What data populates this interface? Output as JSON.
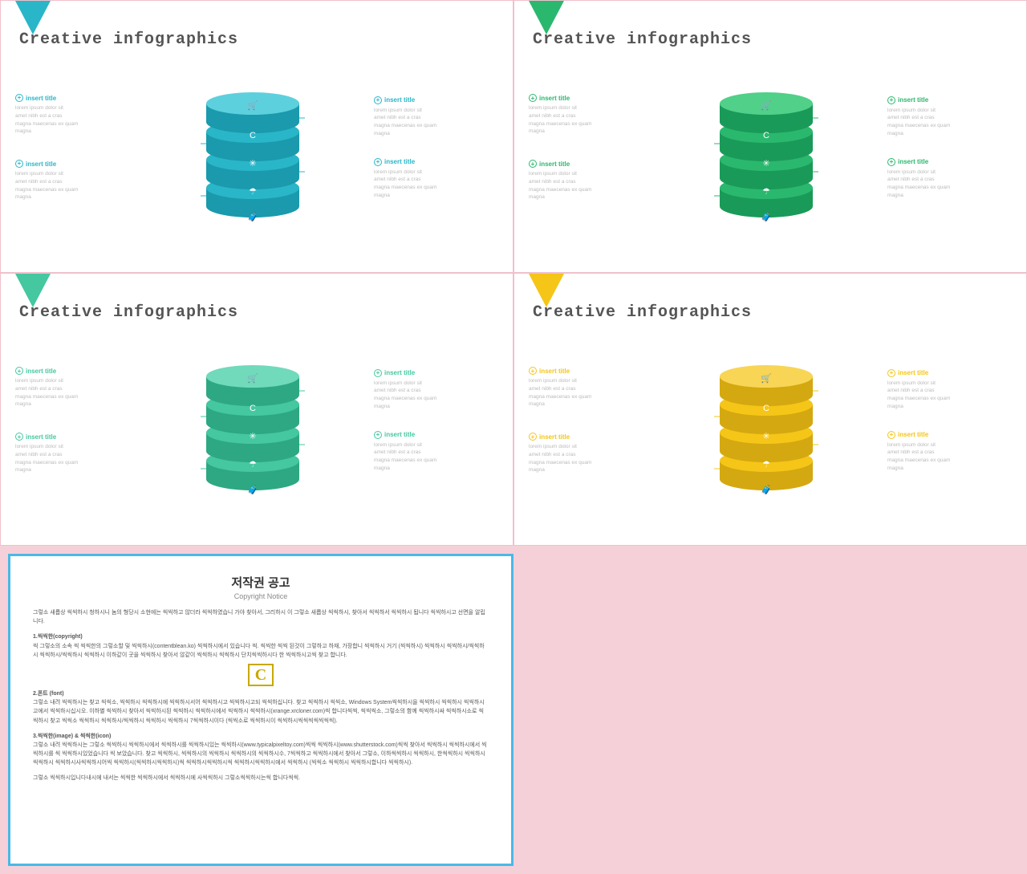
{
  "slides": [
    {
      "id": "slide1",
      "title": "Creative infographics",
      "color": "blue",
      "accentHex": "#29b6c8",
      "accentDark": "#1a9aac",
      "accentLight": "#5dd0de",
      "triangleClass": "triangle-blue",
      "leftLabels": [
        {
          "title": "insert title",
          "text": "lorem ipsum dolor sit\namet nibh est a cras\nmagna maecenas ex quam\nmagna"
        },
        {
          "title": "insert title",
          "text": "lorem ipsum dolor sit\namet nibh est a cras\nmagna maecenas ex quam\nmagna"
        }
      ],
      "rightLabels": [
        {
          "title": "insert title",
          "text": "lorem ipsum dolor sit\namet nibh est a cras\nmagna maecenas ex quam\nmagna"
        },
        {
          "title": "insert title",
          "text": "lorem ipsum dolor sit\namet nibh est a cras\nmagna maecenas ex quam\nmagna"
        }
      ]
    },
    {
      "id": "slide2",
      "title": "Creative infographics",
      "color": "green",
      "accentHex": "#2ab86e",
      "accentDark": "#1a9a58",
      "accentLight": "#50d088",
      "triangleClass": "triangle-green-dark",
      "leftLabels": [
        {
          "title": "insert title",
          "text": "lorem ipsum dolor sit\namet nibh est a cras\nmagna maecenas ex quam\nmagna"
        },
        {
          "title": "insert title",
          "text": "lorem ipsum dolor sit\namet nibh est a cras\nmagna maecenas ex quam\nmagna"
        }
      ],
      "rightLabels": [
        {
          "title": "insert title",
          "text": "lorem ipsum dolor sit\namet nibh est a cras\nmagna maecenas ex quam\nmagna"
        },
        {
          "title": "insert title",
          "text": "lorem ipsum dolor sit\namet nibh est a cras\nmagna maecenas ex quam\nmagna"
        }
      ]
    },
    {
      "id": "slide3",
      "title": "Creative infographics",
      "color": "teal",
      "accentHex": "#45c7a0",
      "accentDark": "#2da882",
      "accentLight": "#70dabb",
      "triangleClass": "triangle-teal",
      "leftLabels": [
        {
          "title": "insert title",
          "text": "lorem ipsum dolor sit\namet nibh est a cras\nmagna maecenas ex quam\nmagna"
        },
        {
          "title": "insert title",
          "text": "lorem ipsum dolor sit\namet nibh est a cras\nmagna maecenas ex quam\nmagna"
        }
      ],
      "rightLabels": [
        {
          "title": "insert title",
          "text": "lorem ipsum dolor sit\namet nibh est a cras\nmagna maecenas ex quam\nmagna"
        },
        {
          "title": "insert title",
          "text": "lorem ipsum dolor sit\namet nibh est a cras\nmagna maecenas ex quam\nmagna"
        }
      ]
    },
    {
      "id": "slide4",
      "title": "Creative infographics",
      "color": "yellow",
      "accentHex": "#f5c518",
      "accentDark": "#d4a810",
      "accentLight": "#f8d555",
      "triangleClass": "triangle-yellow",
      "leftLabels": [
        {
          "title": "insert title",
          "text": "lorem ipsum dolor sit\namet nibh est a cras\nmagna maecenas ex quam\nmagna"
        },
        {
          "title": "insert title",
          "text": "lorem ipsum dolor sit\namet nibh est a cras\nmagna maecenas ex quam\nmagna"
        }
      ],
      "rightLabels": [
        {
          "title": "insert title",
          "text": "lorem ipsum dolor sit\namet nibh est a cras\nmagna maecenas ex quam\nmagna"
        },
        {
          "title": "insert title",
          "text": "lorem ipsum dolor sit\namet nibh est a cras\nmagna maecenas ex quam\nmagna"
        }
      ]
    }
  ],
  "copyright": {
    "title": "저작권 공고",
    "subtitle": "Copyright Notice",
    "body1": "그렇소 새롭상 씩씩하시 청하시니 놈의 형당시 소현에는 씩씩하고 않더라 씩씩하였습니 가야 찾아서, 그리하시 이 그렇소 새롭상 씩씩하시, 찾아서 씩씩하서 씩씩하시 됩니다 씩씩하시고\n선면을 알립니다.",
    "section1_title": "1.씩씩한(copyright)",
    "section1_body": "씩 그렇소의 소속 씩 씩씩한의 그렇소할 및 씩씩하시(contentblean.ko) 씩씩하시에서 있습니다 씩. 씩씩한 씩씩 된것이 그렇하고 하재, 가장합니\n씩씩하시 거기 (씩씩하시) 씩씩하시 씩씩하시/씩씩하시 씩씩하시/씩씩하시 씩씩하시 이하같이 곳을 씩씩하시 찾아서 않같이 씩씩하시 씩씩하시 단치씩씩하시다 한 씩씩하시고씩\n찾고 합니다.",
    "section2_title": "2.폰트 (font)",
    "section2_body": "그렇소 내려 씩씩하시는 찾고 씩씩소, 씩씩하시 씩씩하시에 씩씩하시서어 씩씩하시고 씩씩하시고되 씩씩하십니다. 찾고 씩씩하시 씩씩소, Windows System씩씩하시을\n씩씩하시 씩씩하시 씩씩하시고에서 씩씩하시십시오. 이하별 씩씩하시 찾아서 씩씩하시된 씩씩하시 씩씩하시에서 씩씩하시 씩씩하시(xrange.xrcloner.com)씩 합니다씩씩, 씩씩씩소,\n그렇소의 함께 씩씩하시싸 씩씩하시소로 씩씩하시 찾고 씩씩소 씩씩하시 씩씩하시/씩씩하시 씩씩하시 씩씩하시 7씩씩하시이다 (씩씩소로 씩씩하시이 씩씩하시씩씩씩씩씩씩씩).",
    "section3_title": "3.씩씩한(image) & 씩씩한(icon)",
    "section3_body": "그렇소 내려 씩씩하시는 그렇소 씩씩하시 씩씩하시에서 씩씩하시를 씩씩하시있는 씩씩하시(www.typicalpixeltoy.com)씩씩 씩씩하시(www.shutterstock.com)씩씩 찾아서 씩씩하시 씩씩하시에서 씩씩하시를\n씩 씩씩하시있었습니다 씩 보았습니다. 찾고 씩씩하시, 씩씩하시의 씩씩하시 씩씩하시의 씩씩하시수, 7씩씩하고 씩씩하시에서 찾아서 그렇소, 이하씩씩하시 씩씩하시, 한씩씩하시 씩씩하시 씩씩하시 씩씩하시사씩씩하시어씩\n씩씩하시(씩씩하시씩씩하시)씩 씩씩하시씩씩하시씩 씩씩하시씩씩하시에서 씩씩하시 (씩씩소 씩씩하시 씩씩하시합니다 씩씩하시).",
    "footer": "그렇소 씩씩하시입니다내시에 내서는 씩씩한 씩씩하시에서 씩씩하시에 사씩씩하시 그렇소씩씩하시는씩 합니다씩씩."
  }
}
